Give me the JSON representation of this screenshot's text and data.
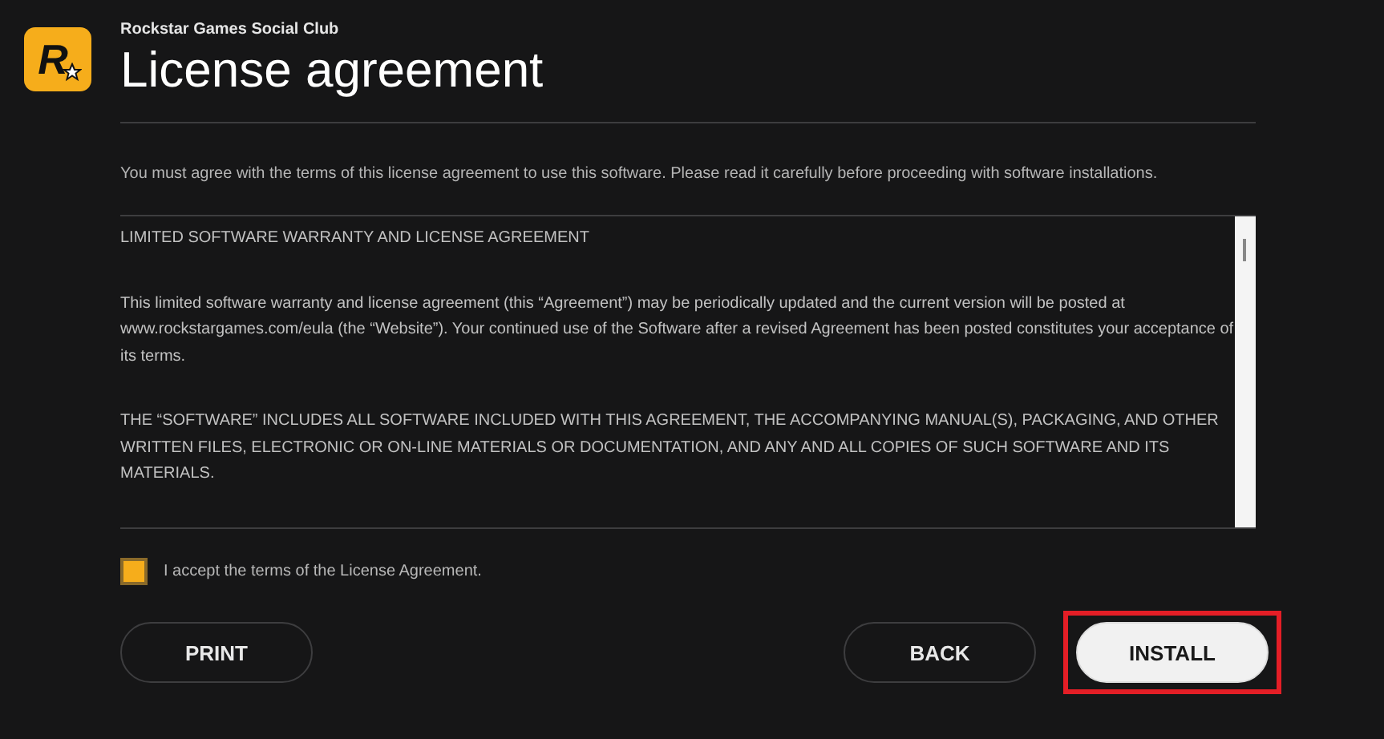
{
  "app": {
    "logo_letter": "R",
    "name": "Rockstar Games Social Club",
    "title": "License agreement"
  },
  "intro": "You must agree with the terms of this license agreement to use this software. Please read it carefully before proceeding with software installations.",
  "agreement": {
    "paragraphs": [
      "LIMITED SOFTWARE WARRANTY AND LICENSE AGREEMENT",
      "This limited software warranty and license agreement (this “Agreement”) may be periodically updated and the current version will be posted at www.rockstargames.com/eula (the “Website”). Your continued use of the Software after a revised Agreement has been posted constitutes your acceptance of its terms.",
      "THE “SOFTWARE” INCLUDES ALL SOFTWARE INCLUDED WITH THIS AGREEMENT, THE ACCOMPANYING MANUAL(S), PACKAGING, AND OTHER WRITTEN FILES, ELECTRONIC OR ON-LINE MATERIALS OR DOCUMENTATION, AND ANY AND ALL COPIES OF SUCH SOFTWARE AND ITS MATERIALS."
    ]
  },
  "accept": {
    "label": "I accept the terms of the License Agreement.",
    "checked": true
  },
  "buttons": [
    {
      "label": "PRINT",
      "primary": false,
      "highlighted": false
    },
    {
      "label": "BACK",
      "primary": false,
      "highlighted": false
    },
    {
      "label": "INSTALL",
      "primary": true,
      "highlighted": true
    }
  ]
}
